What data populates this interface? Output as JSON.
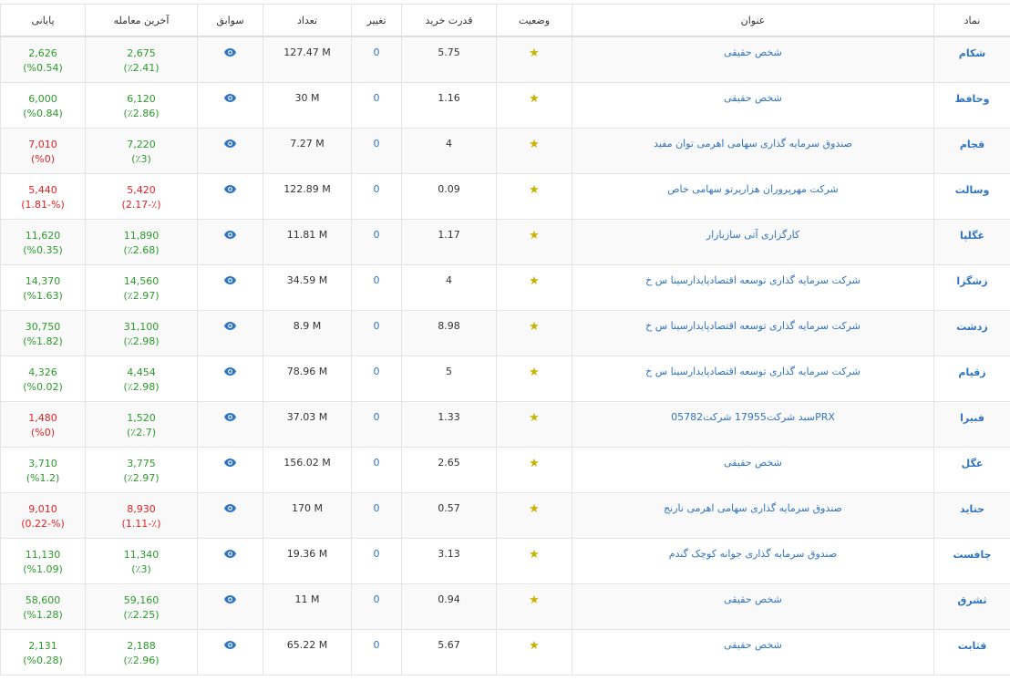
{
  "colors": {
    "link": "#2f74c0",
    "positive": "#2b9a2b",
    "negative": "#e02323",
    "star": "#c9b100"
  },
  "headers": {
    "symbol": "نماد",
    "title": "عنوان",
    "status": "وضعیت",
    "buy_power": "قدرت خرید",
    "change": "تغییر",
    "count": "تعداد",
    "history": "سوابق",
    "last_trade": "آخرین معامله",
    "final": "پایانی"
  },
  "rows": [
    {
      "symbol": "شکام",
      "title": "شخص حقیقی",
      "buy_power": "5.75",
      "change": "0",
      "count": "127.47 M",
      "last_price": "2,675",
      "last_pct": "(٪2.41)",
      "last_trend": "up",
      "final_price": "2,626",
      "final_pct": "(%0.54)",
      "final_trend": "up"
    },
    {
      "symbol": "وحافظ",
      "title": "شخص حقیقی",
      "buy_power": "1.16",
      "change": "0",
      "count": "30 M",
      "last_price": "6,120",
      "last_pct": "(٪2.86)",
      "last_trend": "up",
      "final_price": "6,000",
      "final_pct": "(%0.84)",
      "final_trend": "up"
    },
    {
      "symbol": "قجام",
      "title": "صندوق سرمایه گذاری سهامی اهرمی توان مفید",
      "buy_power": "4",
      "change": "0",
      "count": "7.27 M",
      "last_price": "7,220",
      "last_pct": "(٪3)",
      "last_trend": "up",
      "final_price": "7,010",
      "final_pct": "(%0)",
      "final_trend": "down"
    },
    {
      "symbol": "وسالت",
      "title": "شرکت مهرپروران هزارپرتو سهامی خاص",
      "buy_power": "0.09",
      "change": "0",
      "count": "122.89 M",
      "last_price": "5,420",
      "last_pct": "(٪-2.17)",
      "last_trend": "down",
      "final_price": "5,440",
      "final_pct": "(%-1.81)",
      "final_trend": "down"
    },
    {
      "symbol": "غگلپا",
      "title": "کارگزاری آتی سازبازار",
      "buy_power": "1.17",
      "change": "0",
      "count": "11.81 M",
      "last_price": "11,890",
      "last_pct": "(٪2.68)",
      "last_trend": "up",
      "final_price": "11,620",
      "final_pct": "(%0.35)",
      "final_trend": "up"
    },
    {
      "symbol": "زشگزا",
      "title": "شرکت سرمایه گذاری توسعه اقتصادپایدارسینا س خ",
      "buy_power": "4",
      "change": "0",
      "count": "34.59 M",
      "last_price": "14,560",
      "last_pct": "(٪2.97)",
      "last_trend": "up",
      "final_price": "14,370",
      "final_pct": "(%1.63)",
      "final_trend": "up"
    },
    {
      "symbol": "زدشت",
      "title": "شرکت سرمایه گذاری توسعه اقتصادپایدارسینا س خ",
      "buy_power": "8.98",
      "change": "0",
      "count": "8.9 M",
      "last_price": "31,100",
      "last_pct": "(٪2.98)",
      "last_trend": "up",
      "final_price": "30,750",
      "final_pct": "(%1.82)",
      "final_trend": "up"
    },
    {
      "symbol": "زقیام",
      "title": "شرکت سرمایه گذاری توسعه اقتصادپایدارسینا س خ",
      "buy_power": "5",
      "change": "0",
      "count": "78.96 M",
      "last_price": "4,454",
      "last_pct": "(٪2.98)",
      "last_trend": "up",
      "final_price": "4,326",
      "final_pct": "(%0.02)",
      "final_trend": "up"
    },
    {
      "symbol": "فبیرا",
      "title": "PRXسبد شرکت17955 شرکت05782",
      "buy_power": "1.33",
      "change": "0",
      "count": "37.03 M",
      "last_price": "1,520",
      "last_pct": "(٪2.7)",
      "last_trend": "up",
      "final_price": "1,480",
      "final_pct": "(%0)",
      "final_trend": "down"
    },
    {
      "symbol": "غگل",
      "title": "شخص حقیقی",
      "buy_power": "2.65",
      "change": "0",
      "count": "156.02 M",
      "last_price": "3,775",
      "last_pct": "(٪2.97)",
      "last_trend": "up",
      "final_price": "3,710",
      "final_pct": "(%1.2)",
      "final_trend": "up"
    },
    {
      "symbol": "حتاید",
      "title": "صندوق سرمایه گذاری سهامی اهرمی نارنج",
      "buy_power": "0.57",
      "change": "0",
      "count": "170 M",
      "last_price": "8,930",
      "last_pct": "(٪-1.11)",
      "last_trend": "down",
      "final_price": "9,010",
      "final_pct": "(%-0.22)",
      "final_trend": "down"
    },
    {
      "symbol": "چافست",
      "title": "صندوق سرمایه گذاری جوانه کوچک گندم",
      "buy_power": "3.13",
      "change": "0",
      "count": "19.36 M",
      "last_price": "11,340",
      "last_pct": "(٪3)",
      "last_trend": "up",
      "final_price": "11,130",
      "final_pct": "(%1.09)",
      "final_trend": "up"
    },
    {
      "symbol": "ثشرق",
      "title": "شخص حقیقی",
      "buy_power": "0.94",
      "change": "0",
      "count": "11 M",
      "last_price": "59,160",
      "last_pct": "(٪2.25)",
      "last_trend": "up",
      "final_price": "58,600",
      "final_pct": "(%1.28)",
      "final_trend": "up"
    },
    {
      "symbol": "قثابت",
      "title": "شخص حقیقی",
      "buy_power": "5.67",
      "change": "0",
      "count": "65.22 M",
      "last_price": "2,188",
      "last_pct": "(٪2.96)",
      "last_trend": "up",
      "final_price": "2,131",
      "final_pct": "(%0.28)",
      "final_trend": "up"
    }
  ],
  "icons": {
    "status": "star-icon",
    "history": "eye-icon"
  }
}
